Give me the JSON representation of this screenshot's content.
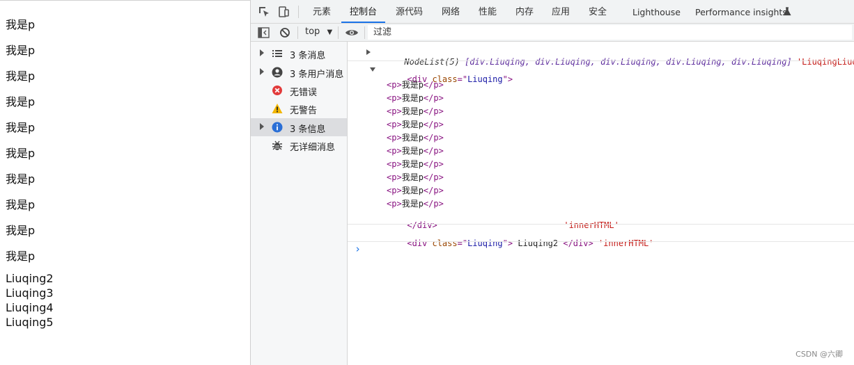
{
  "page": {
    "p_lines": [
      "我是p",
      "我是p",
      "我是p",
      "我是p",
      "我是p",
      "我是p",
      "我是p",
      "我是p",
      "我是p",
      "我是p"
    ],
    "liuqing_lines": [
      "Liuqing2",
      "Liuqing3",
      "Liuqing4",
      "Liuqing5"
    ]
  },
  "devtools": {
    "tabs": [
      "元素",
      "控制台",
      "源代码",
      "网络",
      "性能",
      "内存",
      "应用",
      "安全",
      "Lighthouse",
      "Performance insights"
    ],
    "active_tab": "控制台",
    "toolbar": {
      "context": "top",
      "filter_placeholder": "过滤"
    },
    "sidebar": [
      {
        "label": "3 条消息",
        "icon": "list-icon",
        "expandable": true
      },
      {
        "label": "3 条用户消息",
        "icon": "user-icon",
        "expandable": true
      },
      {
        "label": "无错误",
        "icon": "error-icon",
        "expandable": false
      },
      {
        "label": "无警告",
        "icon": "warning-icon",
        "expandable": false
      },
      {
        "label": "3 条信息",
        "icon": "info-icon",
        "expandable": true,
        "selected": true
      },
      {
        "label": "无详细消息",
        "icon": "bug-icon",
        "expandable": false
      }
    ],
    "console": {
      "nodelist": {
        "prefix": "NodeList(5) ",
        "items": "[div.Liuqing, div.Liuqing, div.Liuqing, div.Liuqing, div.Liuqing]",
        "string": "'LiuqingLiuqing'"
      },
      "div_open": {
        "tag_start": "<div ",
        "attr": "class",
        "eq": "=\"",
        "val": "Liuqing",
        "close": "\">"
      },
      "p_open": "<p>",
      "p_text": "我是p",
      "p_close": "</p>",
      "p_count": 10,
      "div_close": "</div>",
      "inner1": "'innerHTML'",
      "line3": {
        "text": " Liuqing2 ",
        "div_close": "</div>",
        "string": "'innerHTML'"
      },
      "prompt": "›"
    },
    "watermark": "CSDN @六卿"
  }
}
